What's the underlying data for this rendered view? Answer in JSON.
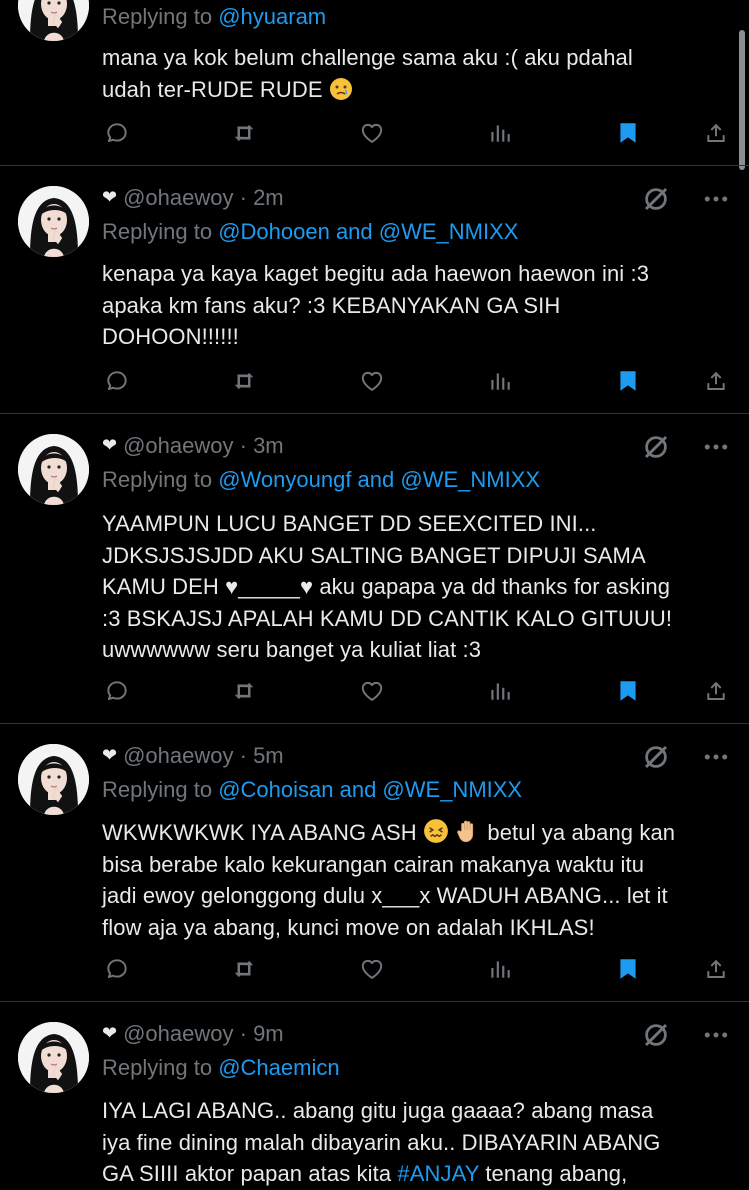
{
  "colors": {
    "accent": "#1d9bf0",
    "muted": "#71767b",
    "text": "#e7e9ea",
    "bookmark": "#1d9bf0",
    "divider": "#2f3336"
  },
  "icons": {
    "reply": "comment-icon",
    "repost": "retweet-icon",
    "like": "heart-icon",
    "views": "bar-chart-icon",
    "bookmark": "bookmark-filled-icon",
    "share": "share-icon",
    "grok": "slashed-circle-icon",
    "more": "more-dots-icon"
  },
  "replying_prefix": "Replying to",
  "tweets": [
    {
      "reply_to": "@hyuaram",
      "text1": "mana ya kok belum challenge sama aku :( aku pdahal",
      "text2": "udah ter-RUDE RUDE"
    },
    {
      "handle": "@ohaewoy",
      "time": "· 2m",
      "reply_to": "@Dohooen and @WE_NMIXX",
      "lines": [
        "kenapa ya kaya kaget begitu ada haewon haewon ini :3",
        "apaka km fans aku? :3 KEBANYAKAN GA SIH",
        "DOHOON!!!!!!"
      ]
    },
    {
      "handle": "@ohaewoy",
      "time": "· 3m",
      "reply_to": "@Wonyoungf and @WE_NMIXX",
      "lines": [
        "YAAMPUN LUCU BANGET DD SEEXCITED INI...",
        "JDKSJSJSJDD AKU SALTING BANGET DIPUJI SAMA",
        "KAMU DEH ♥_____♥ aku gapapa ya dd thanks for asking",
        ":3 BSKAJSJ APALAH KAMU DD CANTIK KALO GITUUU!",
        "uwwwwww seru banget ya kuliat liat :3"
      ]
    },
    {
      "handle": "@ohaewoy",
      "time": "· 5m",
      "reply_to": "@Cohoisan and @WE_NMIXX",
      "line1": "WKWKWKWK IYA ABANG ASH",
      "line1b": "betul ya abang kan",
      "lines": [
        "bisa berabe kalo kekurangan cairan makanya waktu itu",
        "jadi ewoy gelonggong dulu x___x WADUH ABANG... let it",
        "flow aja ya abang, kunci move on adalah IKHLAS!"
      ]
    },
    {
      "handle": "@ohaewoy",
      "time": "· 9m",
      "reply_to": "@Chaemicn",
      "lines": [
        "IYA LAGI ABANG.. abang gitu juga gaaaa? abang masa",
        "iya fine dining malah dibayarin aku.. DIBAYARIN ABANG"
      ],
      "line3a": "GA SIIII aktor papan atas kita",
      "hashtag": "#ANJAY",
      "line3b": "tenang abang,"
    }
  ]
}
